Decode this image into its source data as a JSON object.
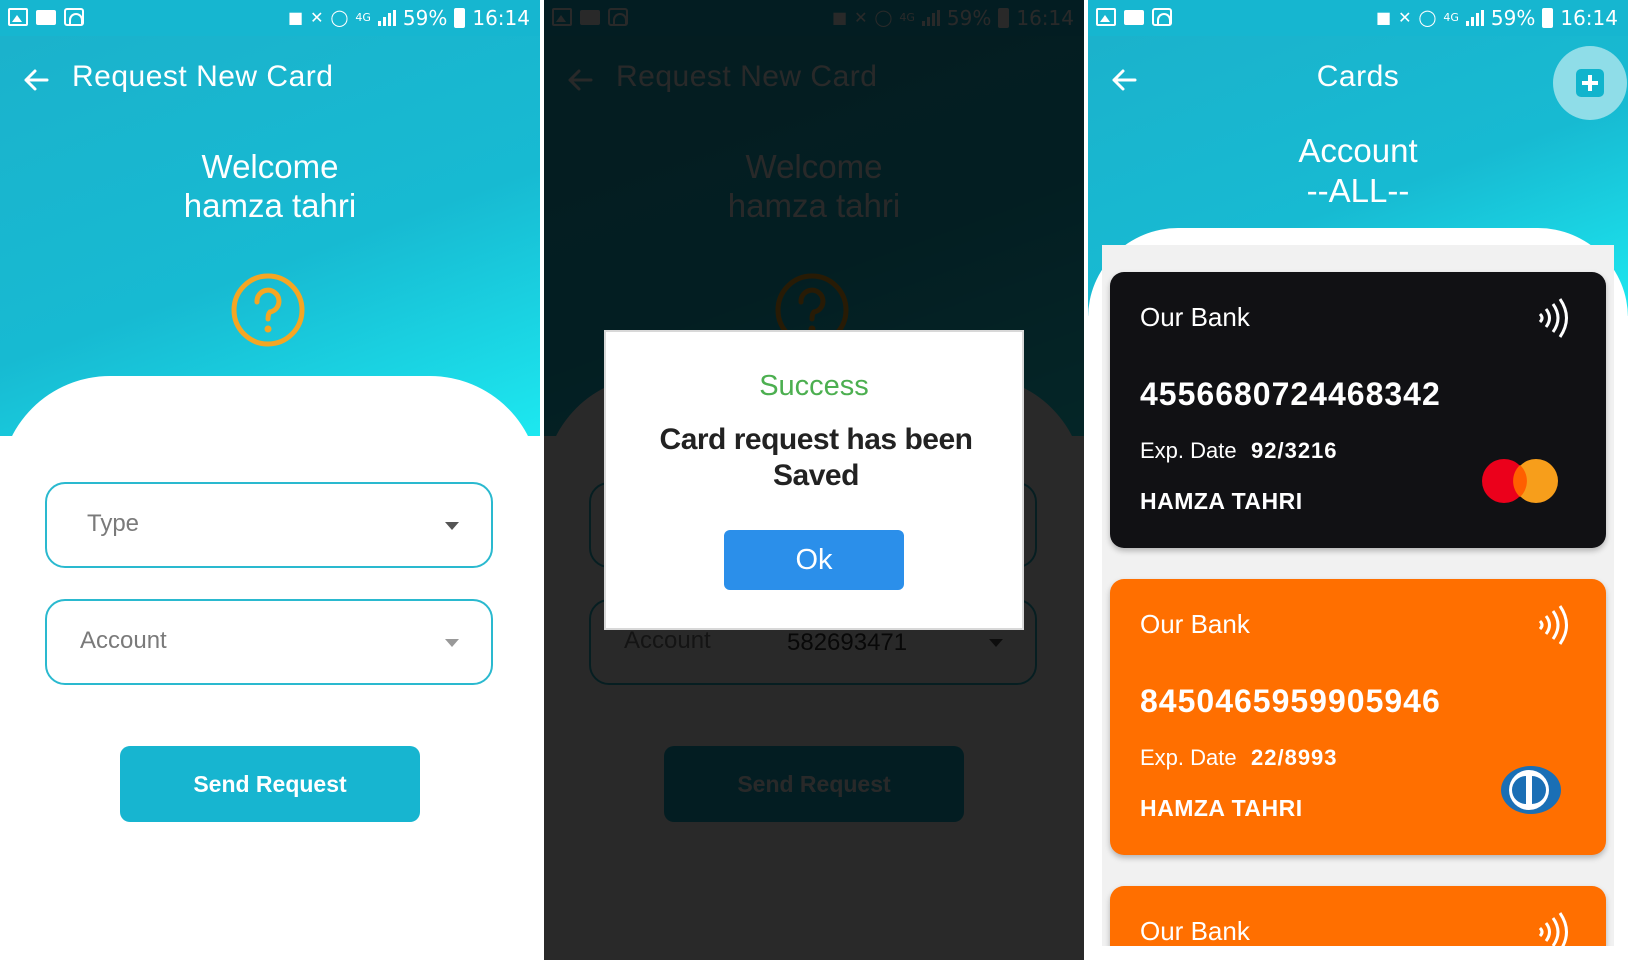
{
  "status_bar": {
    "battery": "59%",
    "time": "16:14",
    "network": "4G"
  },
  "request_screen": {
    "title": "Request New Card",
    "welcome_line1": "Welcome",
    "welcome_line2": "hamza tahri",
    "type_label": "Type",
    "account_label": "Account",
    "send_button": "Send Request"
  },
  "dialog_screen": {
    "account_value": "582693471",
    "dialog_title": "Success",
    "dialog_message": "Card request has been Saved",
    "ok_button": "Ok"
  },
  "cards_screen": {
    "title": "Cards",
    "account_label": "Account",
    "account_value": "--ALL--",
    "cards": [
      {
        "bank": "Our Bank",
        "number": "4556680724468342",
        "exp_label": "Exp. Date",
        "exp_value": "92/3216",
        "holder": "HAMZA TAHRI",
        "color": "#111114",
        "network_logo": "mastercard-logo"
      },
      {
        "bank": "Our Bank",
        "number": "8450465959905946",
        "exp_label": "Exp. Date",
        "exp_value": "22/8993",
        "holder": "HAMZA TAHRI",
        "color": "#ff6f00",
        "network_logo": "diners-club-logo"
      },
      {
        "bank": "Our Bank",
        "color": "#ff6f00"
      }
    ]
  },
  "colors": {
    "accent": "#17b5d0",
    "success": "#4caf50",
    "ok_button": "#2b8fea",
    "warning_icon": "#f5a623"
  }
}
